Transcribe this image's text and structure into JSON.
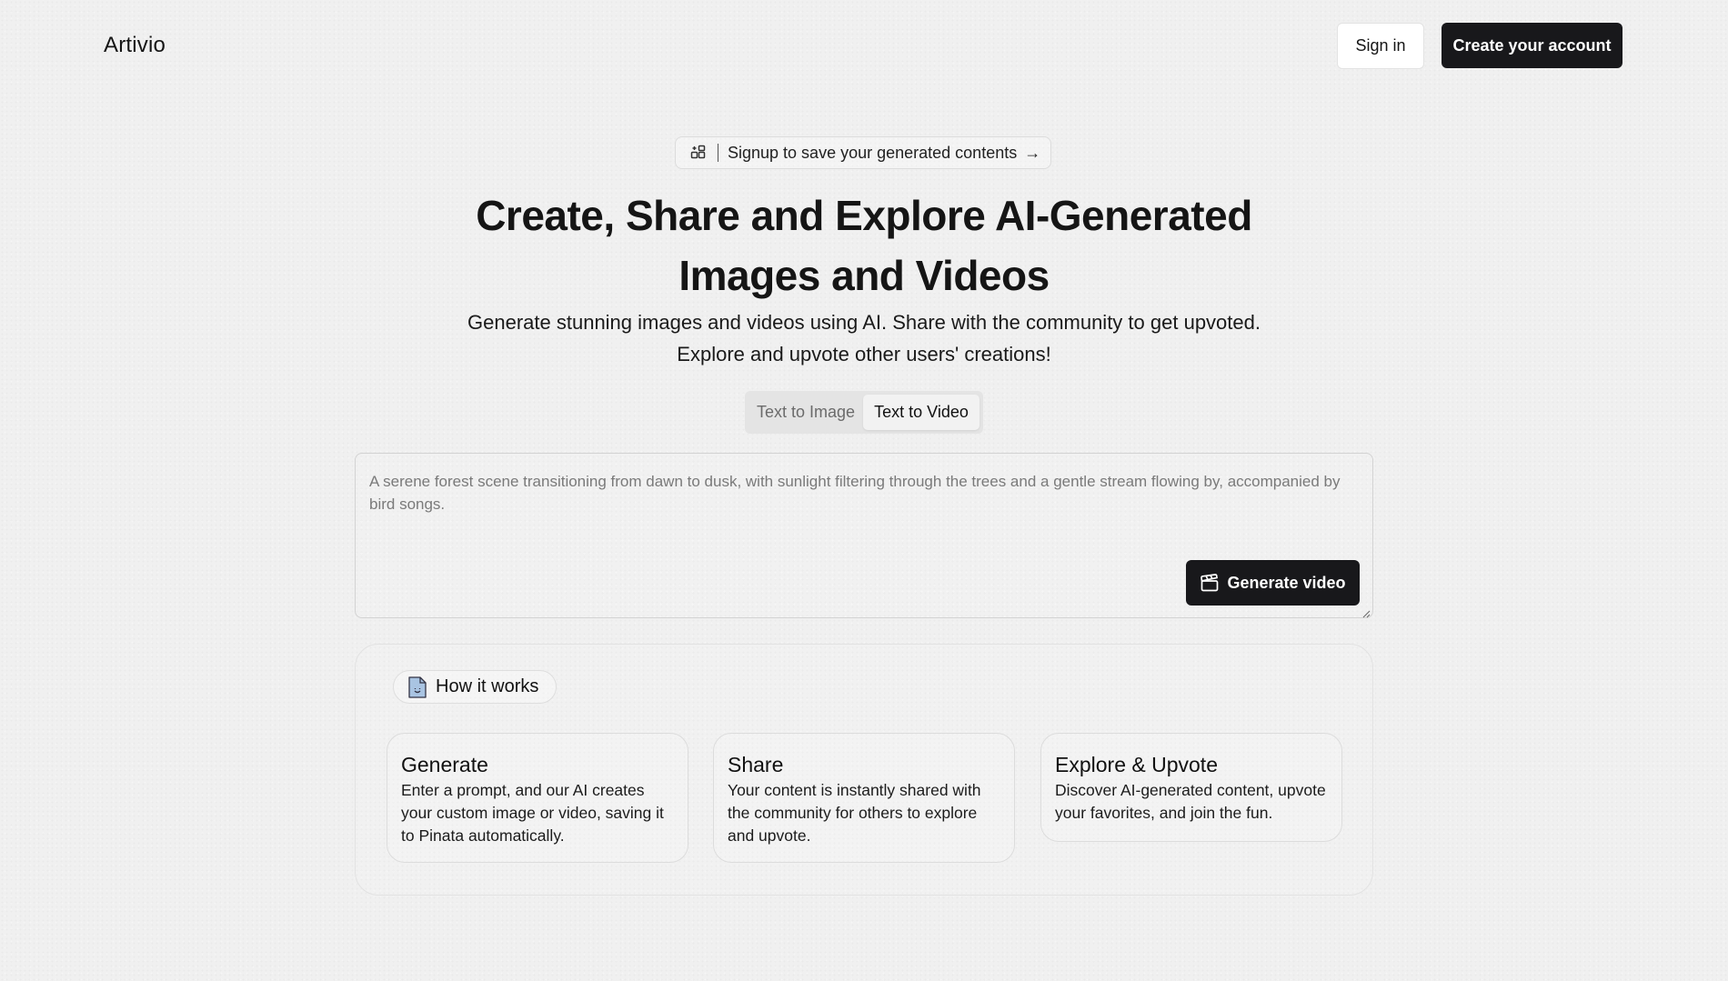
{
  "header": {
    "logo": "Artivio",
    "sign_in_label": "Sign in",
    "create_account_label": "Create your account"
  },
  "banner": {
    "label": "Signup to save your generated contents",
    "arrow": "→"
  },
  "hero": {
    "headline": "Create, Share and Explore AI-Generated Images and Videos",
    "subtitle_line1": "Generate stunning images and videos using AI. Share with the community to get upvoted.",
    "subtitle_line2": "Explore and upvote other users' creations!"
  },
  "tabs": [
    {
      "label": "Text to Image",
      "active": false
    },
    {
      "label": "Text to Video",
      "active": true
    }
  ],
  "prompt": {
    "value": "",
    "placeholder": "A serene forest scene transitioning from dawn to dusk, with sunlight filtering through the trees and a gentle stream flowing by, accompanied by bird songs.",
    "generate_label": "Generate video"
  },
  "how_it_works": {
    "badge_label": "How it works",
    "cards": [
      {
        "title": "Generate",
        "text": "Enter a prompt, and our AI creates your custom image or video, saving it to Pinata automatically."
      },
      {
        "title": "Share",
        "text": "Your content is instantly shared with the community for others to explore and upvote."
      },
      {
        "title": "Explore & Upvote",
        "text": "Discover AI-generated content, upvote your favorites, and join the fun."
      }
    ]
  },
  "icons": {
    "banner_icon": "grid-plus-icon",
    "generate_icon": "clapperboard-icon",
    "how_icon": "document-smile-icon"
  },
  "colors": {
    "primary_button": "#18181b",
    "background": "#f0f0f0",
    "doc_icon_fill": "#a9c4e2"
  }
}
